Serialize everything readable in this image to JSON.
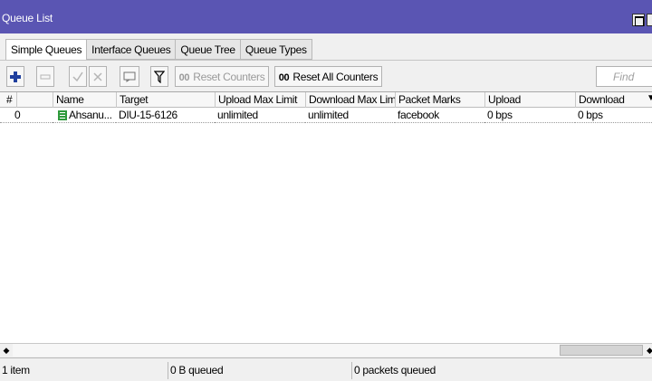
{
  "window": {
    "title": "Queue List"
  },
  "tabs": [
    {
      "label": "Simple Queues",
      "active": true
    },
    {
      "label": "Interface Queues",
      "active": false
    },
    {
      "label": "Queue Tree",
      "active": false
    },
    {
      "label": "Queue Types",
      "active": false
    }
  ],
  "toolbar": {
    "add_icon": "plus-icon",
    "remove_icon": "minus-icon",
    "enable_icon": "check-icon",
    "disable_icon": "x-icon",
    "comment_icon": "comment-icon",
    "filter_icon": "filter-icon",
    "reset_counters_prefix": "00",
    "reset_counters_label": "Reset Counters",
    "reset_all_prefix": "00",
    "reset_all_label": "Reset All Counters",
    "find_placeholder": "Find"
  },
  "table": {
    "columns": [
      "#",
      "Name",
      "Target",
      "Upload Max Limit",
      "Download Max Limit",
      "Packet Marks",
      "Upload",
      "Download"
    ],
    "rows": [
      {
        "num": "0",
        "name": "Ahsanu...",
        "target": "DIU-15-6126",
        "upload_max_limit": "unlimited",
        "download_max_limit": "unlimited",
        "packet_marks": "facebook",
        "upload": "0 bps",
        "download": "0 bps"
      }
    ]
  },
  "status": {
    "items": "1 item",
    "queued": "0 B queued",
    "packets_queued": "0 packets queued"
  },
  "colors": {
    "titlebar": "#5a55b3",
    "add_icon": "#1f3f9e",
    "queue_icon": "#2f9a3c"
  }
}
